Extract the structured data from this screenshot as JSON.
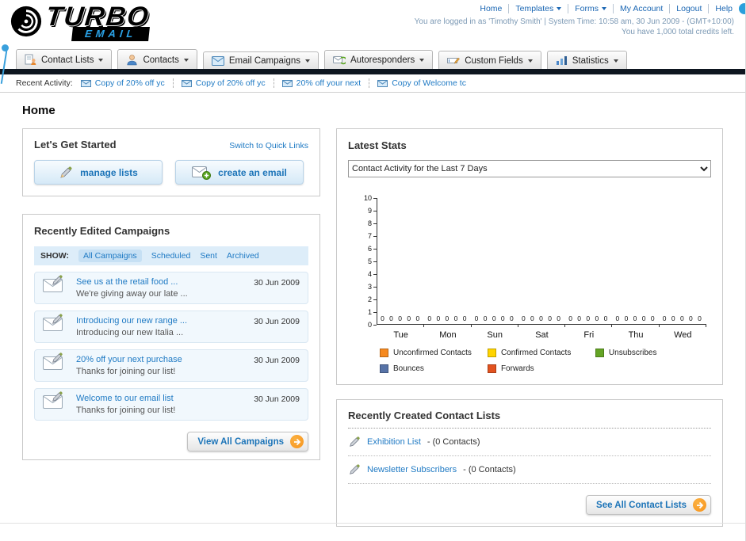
{
  "header": {
    "logo_title": "TURBO",
    "logo_subtitle": "EMAIL",
    "links": [
      {
        "label": "Home"
      },
      {
        "label": "Templates"
      },
      {
        "label": "Forms"
      },
      {
        "label": "My Account"
      },
      {
        "label": "Logout"
      },
      {
        "label": "Help"
      }
    ],
    "login_info": "You are logged in as 'Timothy Smith' | System Time: 10:58 am, 30 Jun 2009 - (GMT+10:00)",
    "credits_info": "You have 1,000 total credits left."
  },
  "nav": {
    "tabs": [
      {
        "label": "Contact Lists"
      },
      {
        "label": "Contacts"
      },
      {
        "label": "Email Campaigns"
      },
      {
        "label": "Autoresponders"
      },
      {
        "label": "Custom Fields"
      },
      {
        "label": "Statistics"
      }
    ]
  },
  "recent_activity": {
    "label": "Recent Activity:",
    "items": [
      {
        "label": "Copy of 20% off yc"
      },
      {
        "label": "Copy of 20% off yc"
      },
      {
        "label": "20% off your next"
      },
      {
        "label": "Copy of Welcome tc"
      }
    ]
  },
  "page": {
    "title": "Home"
  },
  "get_started": {
    "title": "Let's Get Started",
    "switch_link": "Switch to Quick Links",
    "manage_lists_label": "manage lists",
    "create_email_label": "create an email"
  },
  "campaigns": {
    "title": "Recently Edited Campaigns",
    "show_label": "SHOW:",
    "filters": [
      {
        "label": "All Campaigns"
      },
      {
        "label": "Scheduled"
      },
      {
        "label": "Sent"
      },
      {
        "label": "Archived"
      }
    ],
    "active_filter": "All Campaigns",
    "items": [
      {
        "title": "See us at the retail food ...",
        "subtitle": "We're giving away our late ...",
        "date": "30 Jun 2009"
      },
      {
        "title": "Introducing our new range ...",
        "subtitle": "Introducing our new Italia ...",
        "date": "30 Jun 2009"
      },
      {
        "title": "20% off your next purchase",
        "subtitle": "Thanks for joining our list!",
        "date": "30 Jun 2009"
      },
      {
        "title": "Welcome to our email list",
        "subtitle": "Thanks for joining our list!",
        "date": "30 Jun 2009"
      }
    ],
    "view_all_label": "View All Campaigns"
  },
  "stats": {
    "title": "Latest Stats",
    "dropdown_value": "Contact Activity for the Last 7 Days"
  },
  "chart_data": {
    "type": "bar",
    "title": "Contact Activity for the Last 7 Days",
    "categories": [
      "Tue",
      "Mon",
      "Sun",
      "Sat",
      "Fri",
      "Thu",
      "Wed"
    ],
    "series": [
      {
        "name": "Unconfirmed Contacts",
        "color": "#f6891f",
        "values": [
          0,
          0,
          0,
          0,
          0,
          0,
          0
        ]
      },
      {
        "name": "Confirmed Contacts",
        "color": "#ffd400",
        "values": [
          0,
          0,
          0,
          0,
          0,
          0,
          0
        ]
      },
      {
        "name": "Unsubscribes",
        "color": "#64a425",
        "values": [
          0,
          0,
          0,
          0,
          0,
          0,
          0
        ]
      },
      {
        "name": "Bounces",
        "color": "#5773a7",
        "values": [
          0,
          0,
          0,
          0,
          0,
          0,
          0
        ]
      },
      {
        "name": "Forwards",
        "color": "#e2521f",
        "values": [
          0,
          0,
          0,
          0,
          0,
          0,
          0
        ]
      }
    ],
    "xlabel": "",
    "ylabel": "",
    "ylim": [
      0,
      10
    ],
    "grid": false,
    "legend_position": "bottom"
  },
  "contact_lists": {
    "title": "Recently Created Contact Lists",
    "items": [
      {
        "name": "Exhibition List",
        "detail": "- (0 Contacts)"
      },
      {
        "name": "Newsletter Subscribers",
        "detail": "- (0 Contacts)"
      }
    ],
    "see_all_label": "See All Contact Lists"
  }
}
